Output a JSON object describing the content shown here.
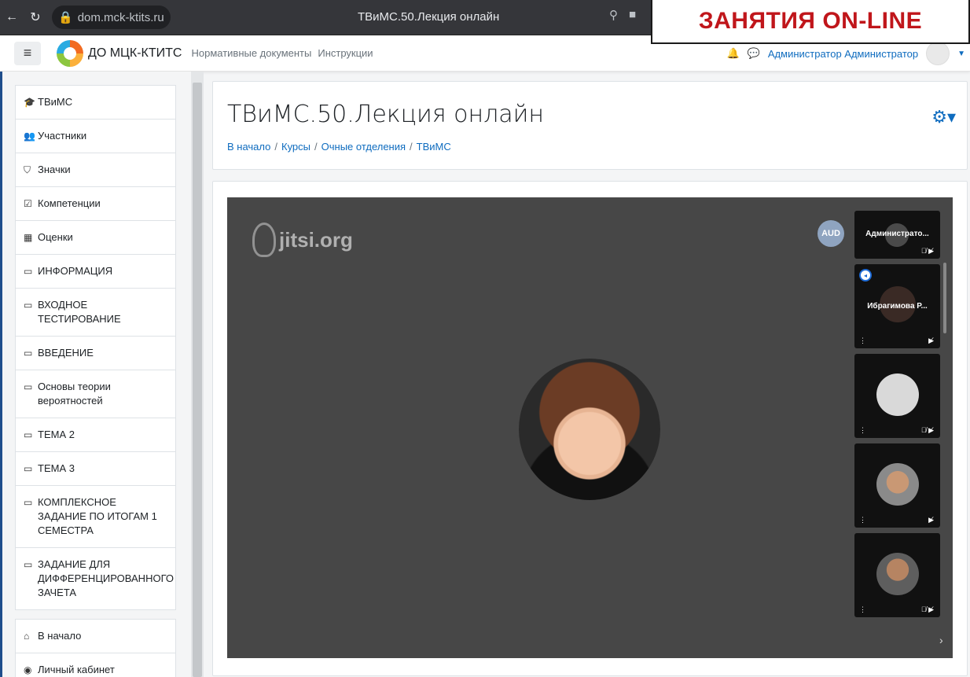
{
  "browser": {
    "url": "dom.mck-ktits.ru",
    "tab_title": "ТВиМС.50.Лекция онлайн"
  },
  "banner": {
    "text": "ЗАНЯТИЯ ON-LINE"
  },
  "navbar": {
    "site_name": "ДО МЦК-КТИТС",
    "links": [
      "Нормативные документы",
      "Инструкции"
    ],
    "user_name": "Администратор Администратор"
  },
  "drawer": {
    "items": [
      {
        "icon": "graduation-cap",
        "label": "ТВиМС"
      },
      {
        "icon": "users",
        "label": "Участники"
      },
      {
        "icon": "shield",
        "label": "Значки"
      },
      {
        "icon": "checkbox",
        "label": "Компетенции"
      },
      {
        "icon": "table",
        "label": "Оценки"
      },
      {
        "icon": "folder",
        "label": "ИНФОРМАЦИЯ"
      },
      {
        "icon": "folder",
        "label": "ВХОДНОЕ ТЕСТИРОВАНИЕ"
      },
      {
        "icon": "folder",
        "label": "ВВЕДЕНИЕ"
      },
      {
        "icon": "folder",
        "label": "Основы теории вероятностей"
      },
      {
        "icon": "folder",
        "label": "ТЕМА 2"
      },
      {
        "icon": "folder",
        "label": "ТЕМА 3"
      },
      {
        "icon": "folder",
        "label": "КОМПЛЕКСНОЕ ЗАДАНИЕ ПО ИТОГАМ 1 СЕМЕСТРА"
      },
      {
        "icon": "folder",
        "label": "ЗАДАНИЕ ДЛЯ ДИФФЕРЕНЦИРОВАННОГО ЗАЧЕТА"
      }
    ],
    "bottom_items": [
      {
        "icon": "home",
        "label": "В начало"
      },
      {
        "icon": "dashboard",
        "label": "Личный кабинет"
      }
    ]
  },
  "header": {
    "title": "ТВиМС.50.Лекция онлайн",
    "breadcrumb": [
      "В начало",
      "Курсы",
      "Очные отделения",
      "ТВиМС"
    ]
  },
  "jitsi": {
    "logo_text": "jitsi.org",
    "aud_badge": "AUD",
    "participants": [
      {
        "name": "Администрато..."
      },
      {
        "name": "Ибрагимова Р..."
      }
    ]
  },
  "colors": {
    "accent": "#0f6cbf",
    "banner_text": "#c0161b",
    "stage_bg": "#474747"
  }
}
